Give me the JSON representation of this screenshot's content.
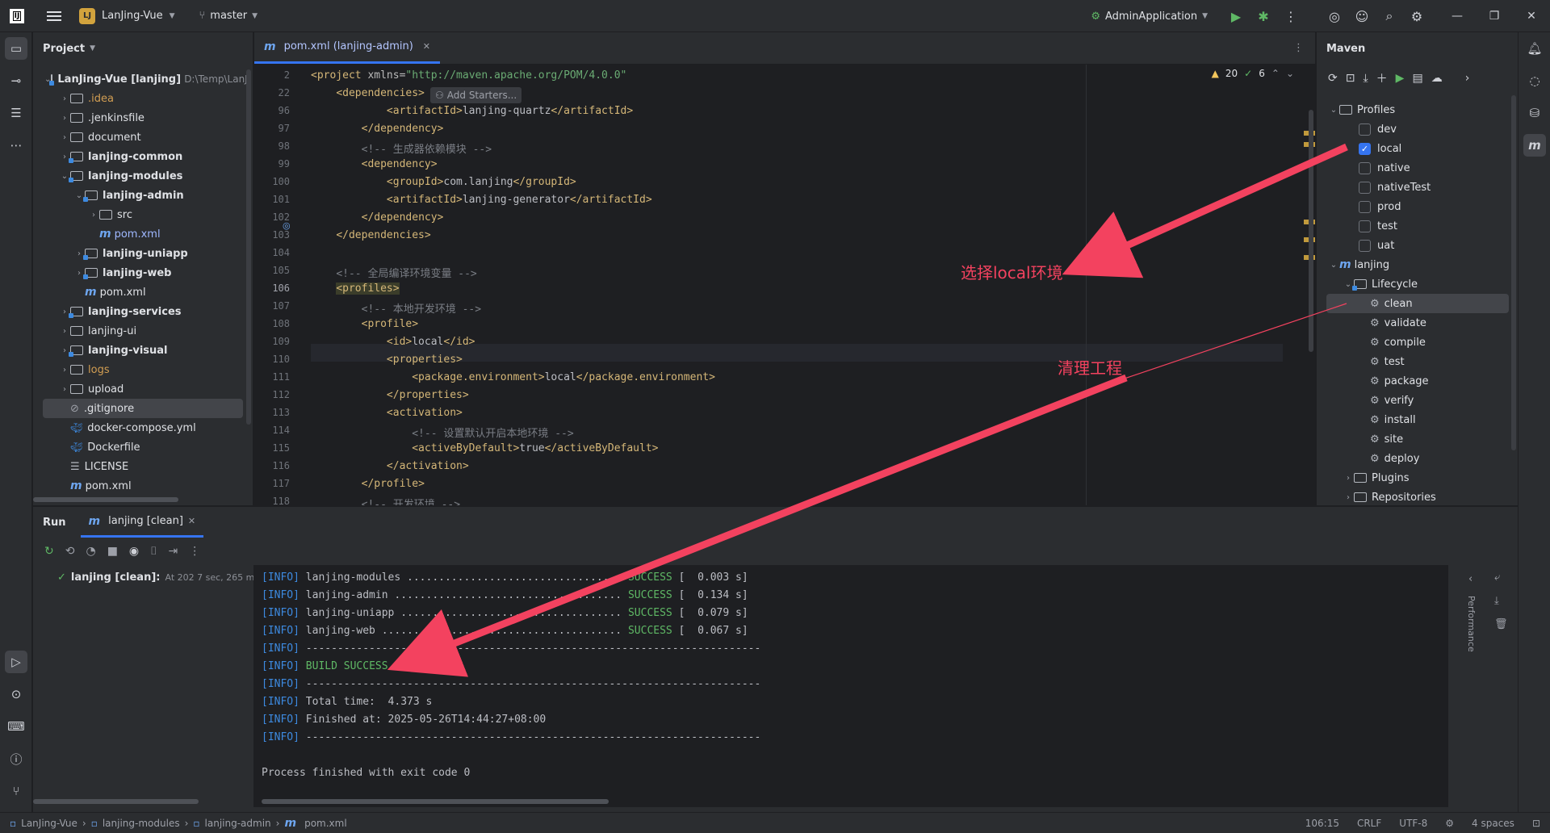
{
  "titlebar": {
    "project_badge": "LJ",
    "project_name": "LanJing-Vue",
    "branch": "master",
    "run_config": "AdminApplication"
  },
  "project_panel": {
    "title": "Project",
    "root_name": "LanJing-Vue [lanjing]",
    "root_path": "D:\\Temp\\LanJ",
    "items": [
      {
        "label": "idea",
        "display": ".idea",
        "style": "orange",
        "indent": 1,
        "chev": true
      },
      {
        "label": ".jenkinsfile",
        "indent": 1,
        "chev": true
      },
      {
        "label": "document",
        "indent": 1,
        "chev": true
      },
      {
        "label": "lanjing-common",
        "indent": 1,
        "chev": true,
        "bold": true,
        "module": true
      },
      {
        "label": "lanjing-modules",
        "indent": 1,
        "chev": true,
        "open": true,
        "bold": true,
        "module": true
      },
      {
        "label": "lanjing-admin",
        "indent": 2,
        "chev": true,
        "open": true,
        "bold": true,
        "module": true
      },
      {
        "label": "src",
        "indent": 3,
        "chev": true
      },
      {
        "label": "pom.xml",
        "indent": 3,
        "maven": true,
        "accent": true
      },
      {
        "label": "lanjing-uniapp",
        "indent": 2,
        "chev": true,
        "bold": true,
        "module": true
      },
      {
        "label": "lanjing-web",
        "indent": 2,
        "chev": true,
        "bold": true,
        "module": true
      },
      {
        "label": "pom.xml",
        "indent": 2,
        "maven": true
      },
      {
        "label": "lanjing-services",
        "indent": 1,
        "chev": true,
        "bold": true,
        "module": true
      },
      {
        "label": "lanjing-ui",
        "indent": 1,
        "chev": true
      },
      {
        "label": "lanjing-visual",
        "indent": 1,
        "chev": true,
        "bold": true,
        "module": true
      },
      {
        "label": "logs",
        "indent": 1,
        "chev": true,
        "style": "orange"
      },
      {
        "label": "upload",
        "indent": 1,
        "chev": true
      },
      {
        "label": ".gitignore",
        "indent": 1,
        "ignore": true,
        "selected": true
      },
      {
        "label": "docker-compose.yml",
        "indent": 1,
        "docker": true
      },
      {
        "label": "Dockerfile",
        "indent": 1,
        "docker": true
      },
      {
        "label": "LICENSE",
        "indent": 1,
        "text": true
      },
      {
        "label": "pom.xml",
        "indent": 1,
        "maven": true
      }
    ]
  },
  "editor": {
    "tab_label": "pom.xml (lanjing-admin)",
    "warnings": "20",
    "checks": "6",
    "add_starters": "Add Starters...",
    "lines": [
      {
        "n": "2",
        "html": "<span class='tag'>&lt;project </span><span class='attr'>xmlns=</span><span class='str'>\"http://maven.apache.org/POM/4.0.0\"</span>"
      },
      {
        "n": "22",
        "html": "    <span class='tag'>&lt;dependencies&gt;</span>"
      },
      {
        "n": "96",
        "html": "            <span class='tag'>&lt;artifactId&gt;</span><span class='txt'>lanjing-quartz</span><span class='tag'>&lt;/artifactId&gt;</span>"
      },
      {
        "n": "97",
        "html": "        <span class='tag'>&lt;/dependency&gt;</span>"
      },
      {
        "n": "98",
        "html": "        <span class='comm'>&lt;!-- 生成器依赖模块 --&gt;</span>"
      },
      {
        "n": "99",
        "html": "        <span class='tag'>&lt;dependency&gt;</span>"
      },
      {
        "n": "100",
        "html": "            <span class='tag'>&lt;groupId&gt;</span><span class='txt'>com.lanjing</span><span class='tag'>&lt;/groupId&gt;</span>"
      },
      {
        "n": "101",
        "html": "            <span class='tag'>&lt;artifactId&gt;</span><span class='txt'>lanjing-generator</span><span class='tag'>&lt;/artifactId&gt;</span>"
      },
      {
        "n": "102",
        "html": "        <span class='tag'>&lt;/dependency&gt;</span>"
      },
      {
        "n": "103",
        "html": "    <span class='tag'>&lt;/dependencies&gt;</span>"
      },
      {
        "n": "104",
        "html": ""
      },
      {
        "n": "105",
        "html": "    <span class='comm'>&lt;!-- 全局编译环境变量 --&gt;</span>"
      },
      {
        "n": "106",
        "html": "    <span class='tag' style='background:#3b3d2a'>&lt;profiles&gt;</span>"
      },
      {
        "n": "107",
        "html": "        <span class='comm'>&lt;!-- 本地开发环境 --&gt;</span>"
      },
      {
        "n": "108",
        "html": "        <span class='tag'>&lt;profile&gt;</span>"
      },
      {
        "n": "109",
        "html": "            <span class='tag'>&lt;id&gt;</span><span class='txt'>local</span><span class='tag'>&lt;/id&gt;</span>"
      },
      {
        "n": "110",
        "html": "            <span class='tag'>&lt;properties&gt;</span>"
      },
      {
        "n": "111",
        "html": "                <span class='tag'>&lt;package.environment&gt;</span><span class='txt'>local</span><span class='tag'>&lt;/package.environment&gt;</span>"
      },
      {
        "n": "112",
        "html": "            <span class='tag'>&lt;/properties&gt;</span>"
      },
      {
        "n": "113",
        "html": "            <span class='tag'>&lt;activation&gt;</span>"
      },
      {
        "n": "114",
        "html": "                <span class='comm'>&lt;!-- 设置默认开启本地环境 --&gt;</span>"
      },
      {
        "n": "115",
        "html": "                <span class='tag'>&lt;activeByDefault&gt;</span><span class='txt'>true</span><span class='tag'>&lt;/activeByDefault&gt;</span>"
      },
      {
        "n": "116",
        "html": "            <span class='tag'>&lt;/activation&gt;</span>"
      },
      {
        "n": "117",
        "html": "        <span class='tag'>&lt;/profile&gt;</span>"
      },
      {
        "n": "118",
        "html": "        <span class='comm'>&lt;!-- 开发环境 --&gt;</span>"
      }
    ]
  },
  "maven": {
    "title": "Maven",
    "profiles_label": "Profiles",
    "profiles": [
      {
        "name": "dev",
        "checked": false
      },
      {
        "name": "local",
        "checked": true
      },
      {
        "name": "native",
        "checked": false
      },
      {
        "name": "nativeTest",
        "checked": false
      },
      {
        "name": "prod",
        "checked": false
      },
      {
        "name": "test",
        "checked": false
      },
      {
        "name": "uat",
        "checked": false
      }
    ],
    "project_label": "lanjing",
    "lifecycle_label": "Lifecycle",
    "lifecycle": [
      "clean",
      "validate",
      "compile",
      "test",
      "package",
      "verify",
      "install",
      "site",
      "deploy"
    ],
    "plugins_label": "Plugins",
    "repositories_label": "Repositories"
  },
  "run": {
    "title": "Run",
    "tab_label": "lanjing [clean]",
    "tree_item": "lanjing [clean]:",
    "tree_item_detail": "At 202 7 sec, 265 ms",
    "console": [
      {
        "tag": "[INFO]",
        "text": " lanjing-modules .................................. ",
        "status": "SUCCESS",
        "time": " [  0.003 s]"
      },
      {
        "tag": "[INFO]",
        "text": " lanjing-admin .................................... ",
        "status": "SUCCESS",
        "time": " [  0.134 s]"
      },
      {
        "tag": "[INFO]",
        "text": " lanjing-uniapp ................................... ",
        "status": "SUCCESS",
        "time": " [  0.079 s]"
      },
      {
        "tag": "[INFO]",
        "text": " lanjing-web ...................................... ",
        "status": "SUCCESS",
        "time": " [  0.067 s]"
      },
      {
        "tag": "[INFO]",
        "text": " ------------------------------------------------------------------------",
        "status": "",
        "time": ""
      },
      {
        "tag": "[INFO]",
        "text": " ",
        "status": "BUILD SUCCESS",
        "time": ""
      },
      {
        "tag": "[INFO]",
        "text": " ------------------------------------------------------------------------",
        "status": "",
        "time": ""
      },
      {
        "tag": "[INFO]",
        "text": " Total time:  4.373 s",
        "status": "",
        "time": ""
      },
      {
        "tag": "[INFO]",
        "text": " Finished at: 2025-05-26T14:44:27+08:00",
        "status": "",
        "time": ""
      },
      {
        "tag": "[INFO]",
        "text": " ------------------------------------------------------------------------",
        "status": "",
        "time": ""
      },
      {
        "tag": "",
        "text": "",
        "status": "",
        "time": ""
      },
      {
        "tag": "",
        "text": "Process finished with exit code 0",
        "status": "",
        "time": ""
      }
    ],
    "performance_label": "Performance"
  },
  "statusbar": {
    "breadcrumbs": [
      "LanJing-Vue",
      "lanjing-modules",
      "lanjing-admin",
      "pom.xml"
    ],
    "position": "106:15",
    "line_sep": "CRLF",
    "encoding": "UTF-8",
    "indent": "4 spaces"
  },
  "annotations": {
    "select_local": "选择local环境",
    "clean_project": "清理工程",
    "color": "#f3425f"
  }
}
